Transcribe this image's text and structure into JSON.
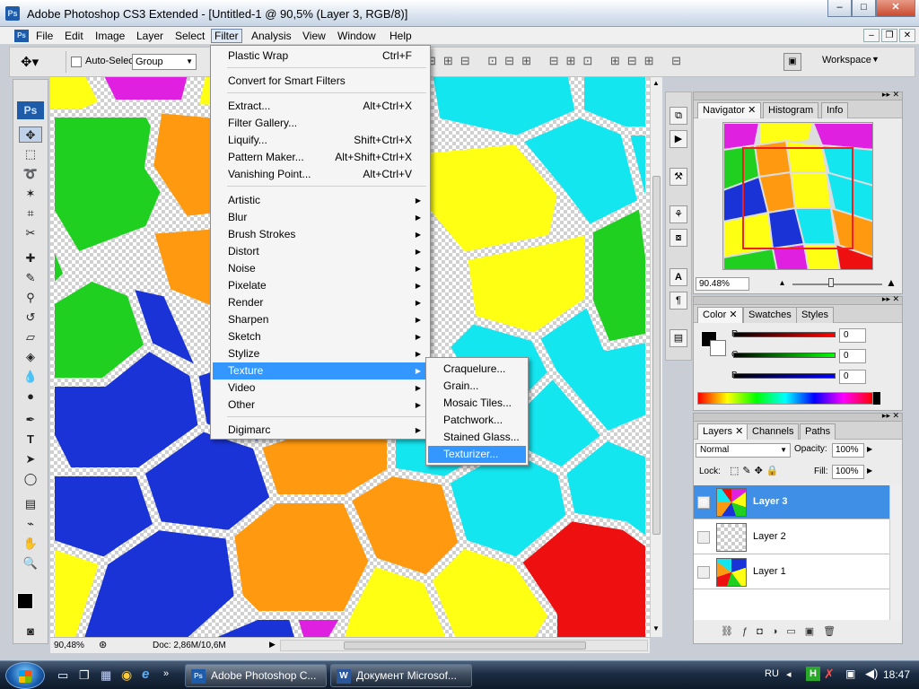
{
  "window": {
    "title": "Adobe Photoshop CS3 Extended - [Untitled-1 @ 90,5% (Layer 3, RGB/8)]",
    "app_icon": "Ps"
  },
  "menubar": [
    "File",
    "Edit",
    "Image",
    "Layer",
    "Select",
    "Filter",
    "Analysis",
    "View",
    "Window",
    "Help"
  ],
  "options": {
    "auto_select_label": "Auto-Select:",
    "auto_select_value": "Group",
    "workspace_label": "Workspace"
  },
  "filter_menu": {
    "plastic_wrap": "Plastic Wrap",
    "plastic_wrap_sc": "Ctrl+F",
    "convert": "Convert for Smart Filters",
    "extract": "Extract...",
    "extract_sc": "Alt+Ctrl+X",
    "gallery": "Filter Gallery...",
    "liquify": "Liquify...",
    "liquify_sc": "Shift+Ctrl+X",
    "pattern": "Pattern Maker...",
    "pattern_sc": "Alt+Shift+Ctrl+X",
    "vanishing": "Vanishing Point...",
    "vanishing_sc": "Alt+Ctrl+V",
    "groups": [
      "Artistic",
      "Blur",
      "Brush Strokes",
      "Distort",
      "Noise",
      "Pixelate",
      "Render",
      "Sharpen",
      "Sketch",
      "Stylize",
      "Texture",
      "Video",
      "Other"
    ],
    "digimarc": "Digimarc"
  },
  "texture_submenu": [
    "Craquelure...",
    "Grain...",
    "Mosaic Tiles...",
    "Patchwork...",
    "Stained Glass...",
    "Texturizer..."
  ],
  "status": {
    "zoom": "90,48%",
    "doc": "Doc: 2,86M/10,6M"
  },
  "navigator": {
    "tabs": [
      "Navigator",
      "Histogram",
      "Info"
    ],
    "zoom": "90.48%"
  },
  "color": {
    "tabs": [
      "Color",
      "Swatches",
      "Styles"
    ],
    "r_label": "R",
    "g_label": "G",
    "b_label": "B",
    "r": "0",
    "g": "0",
    "b": "0"
  },
  "layers": {
    "tabs": [
      "Layers",
      "Channels",
      "Paths"
    ],
    "blend": "Normal",
    "opacity_label": "Opacity:",
    "opacity": "100%",
    "lock_label": "Lock:",
    "fill_label": "Fill:",
    "fill": "100%",
    "items": [
      "Layer 3",
      "Layer 2",
      "Layer 1"
    ]
  },
  "taskbar": {
    "btn1": "Adobe Photoshop C...",
    "btn2": "Документ Microsof...",
    "lang": "RU",
    "time": "18:47"
  },
  "colors": {
    "accent": "#3397ff",
    "cyan": "#14e6f0",
    "yellow": "#ffff14",
    "orange": "#ff9910",
    "blue": "#1a33d6",
    "green": "#20d020",
    "magenta": "#e020e0",
    "red": "#ee1010"
  }
}
